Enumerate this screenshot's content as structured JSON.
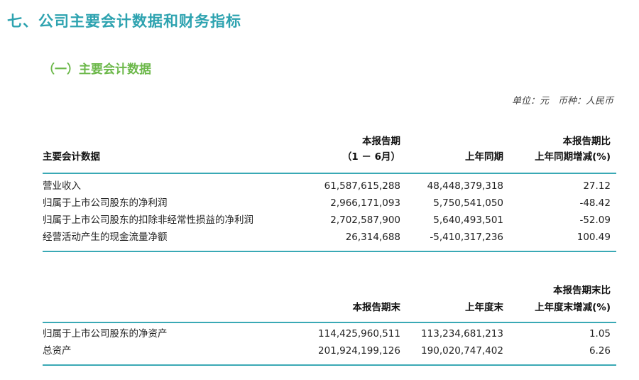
{
  "section_title": "七、公司主要会计数据和财务指标",
  "subsection_title": "（一）主要会计数据",
  "unit_note": "单位：元　币种：人民币",
  "table1": {
    "headers": {
      "item": "主要会计数据",
      "current_line1": "本报告期",
      "current_line2": "（1 － 6月）",
      "prior": "上年同期",
      "change_line1": "本报告期比",
      "change_line2": "上年同期增减(%)"
    },
    "rows": [
      {
        "label": "营业收入",
        "current": "61,587,615,288",
        "prior": "48,448,379,318",
        "change": "27.12"
      },
      {
        "label": "归属于上市公司股东的净利润",
        "current": "2,966,171,093",
        "prior": "5,750,541,050",
        "change": "-48.42"
      },
      {
        "label": "归属于上市公司股东的扣除非经常性损益的净利润",
        "current": "2,702,587,900",
        "prior": "5,640,493,501",
        "change": "-52.09"
      },
      {
        "label": "经营活动产生的现金流量净额",
        "current": "26,314,688",
        "prior": "-5,410,317,236",
        "change": "100.49"
      }
    ]
  },
  "table2": {
    "headers": {
      "current": "本报告期末",
      "prior": "上年度末",
      "change_line1": "本报告期末比",
      "change_line2": "上年度末增减(%)"
    },
    "rows": [
      {
        "label": "归属于上市公司股东的净资产",
        "current": "114,425,960,511",
        "prior": "113,234,681,213",
        "change": "1.05"
      },
      {
        "label": "总资产",
        "current": "201,924,199,126",
        "prior": "190,020,747,402",
        "change": "6.26"
      }
    ]
  },
  "colors": {
    "title": "#2ea3b0",
    "subtitle": "#6cb84a",
    "rule": "#3aa9b5"
  }
}
